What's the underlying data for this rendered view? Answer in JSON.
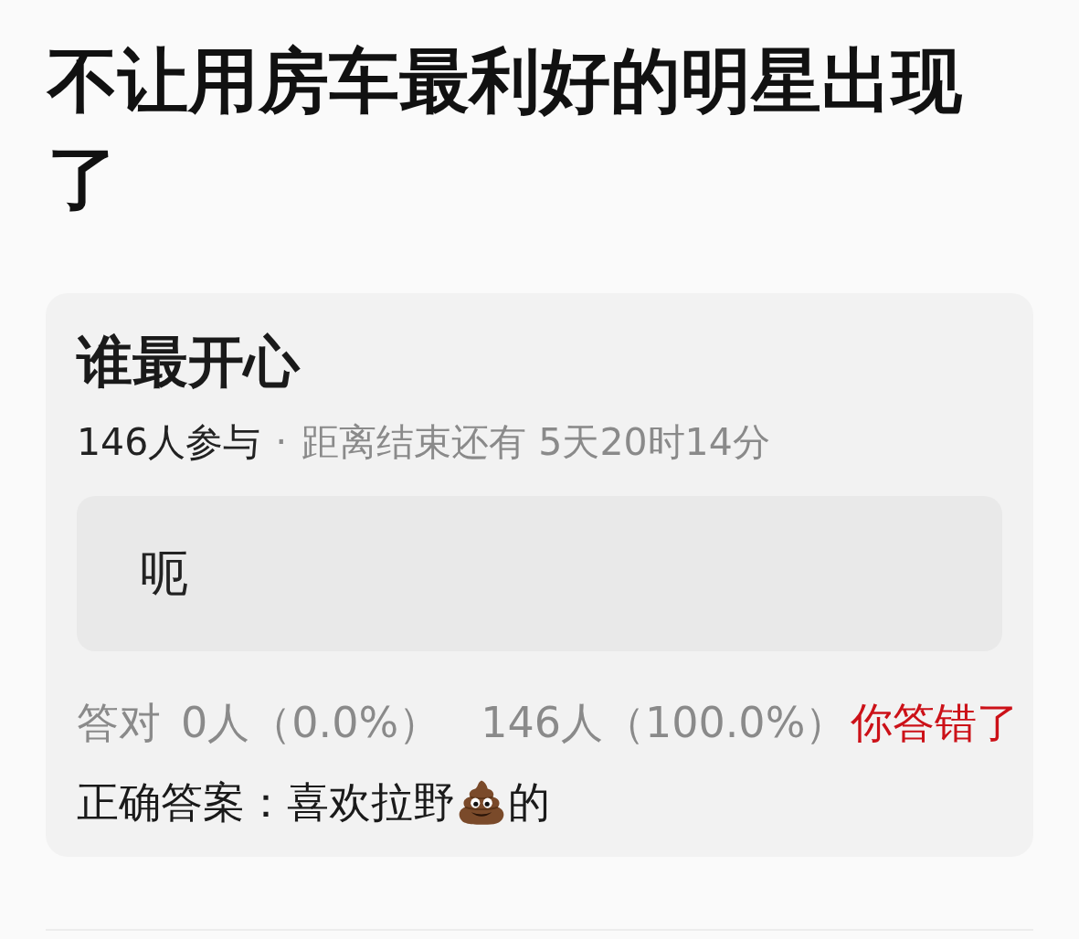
{
  "post": {
    "title": "不让用房车最利好的明星出现了"
  },
  "quiz": {
    "question": "谁最开心",
    "participants": "146人参与",
    "separator": "·",
    "countdown": "距离结束还有 5天20时14分",
    "options": [
      {
        "text": "呃"
      }
    ],
    "stats": {
      "label": "答对",
      "correct_count": "0人（0.0%）",
      "wrong_count": "146人（100.0%）"
    },
    "verdict": {
      "text": "你答错了",
      "correct": false
    },
    "answer": {
      "label": "正确答案：",
      "parts": [
        {
          "kind": "text",
          "text": "喜欢拉野"
        },
        {
          "kind": "emoji"
        },
        {
          "kind": "text",
          "text": "的"
        }
      ]
    }
  }
}
